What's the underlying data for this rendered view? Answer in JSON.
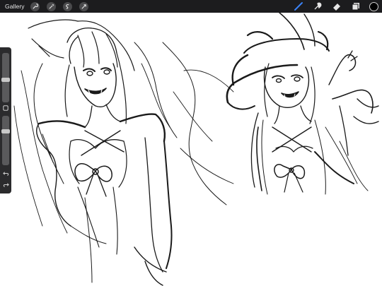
{
  "toolbar": {
    "gallery_label": "Gallery",
    "left_tools": [
      "wrench-icon",
      "magic-wand-icon",
      "selection-icon",
      "transform-icon"
    ],
    "right_tools": [
      "brush-icon",
      "smudge-icon",
      "eraser-icon",
      "layers-icon"
    ],
    "active_tool": "brush-icon",
    "active_color": "#000000"
  },
  "sidebar": {
    "brush_size_level": 0.45,
    "opacity_level": 0.7,
    "buttons": [
      "modify-button",
      "undo-icon",
      "redo-icon"
    ]
  },
  "colors": {
    "toolbar_bg": "#1c1c1e",
    "accent": "#3b82f6",
    "stroke": "#1a1a1a"
  }
}
